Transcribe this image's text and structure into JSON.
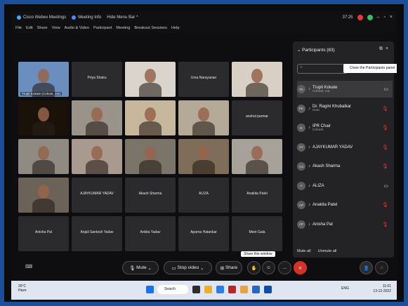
{
  "titlebar": {
    "app": "Cisco Webex Meetings",
    "meeting_info": "Meeting Info",
    "hide_menu": "Hide Menu Bar ^",
    "timer": "37:25"
  },
  "menu": [
    "File",
    "Edit",
    "Share",
    "View",
    "Audio & Video",
    "Participant",
    "Meeting",
    "Breakout Sessions",
    "Help"
  ],
  "tiles": [
    {
      "name": "Trupti Kokate (Cohost, me)",
      "video": true,
      "bg": "#6a8fbf"
    },
    {
      "name": "Priya Shaku",
      "video": false
    },
    {
      "name": "",
      "video": true,
      "bg": "#d9d4cc"
    },
    {
      "name": "Uma Narayanan",
      "video": false
    },
    {
      "name": "",
      "video": true,
      "bg": "#d8d0c4"
    },
    {
      "name": "",
      "video": true,
      "bg": "#1a1208"
    },
    {
      "name": "",
      "video": true,
      "bg": "#9a9389"
    },
    {
      "name": "",
      "video": true,
      "bg": "#c7b79c"
    },
    {
      "name": "",
      "video": true,
      "bg": "#b5aa98"
    },
    {
      "name": "anshul parmar",
      "video": false
    },
    {
      "name": "",
      "video": true,
      "bg": "#8f8a82"
    },
    {
      "name": "",
      "video": true,
      "bg": "#a89a8e"
    },
    {
      "name": "",
      "video": true,
      "bg": "#7b7468"
    },
    {
      "name": "",
      "video": true,
      "bg": "#7e6d58"
    },
    {
      "name": "",
      "video": true,
      "bg": "#a6a29a"
    },
    {
      "name": "",
      "video": true,
      "bg": "#6b6358"
    },
    {
      "name": "AJAYKUMAR YADAV",
      "video": false
    },
    {
      "name": "Akash Sharma",
      "video": false
    },
    {
      "name": "ALIZA",
      "video": false
    },
    {
      "name": "Anakita Patel",
      "video": false
    },
    {
      "name": "Anisha Pal",
      "video": false
    },
    {
      "name": "Anjali Santosh Yadav",
      "video": false
    },
    {
      "name": "Ankita Yadav",
      "video": false
    },
    {
      "name": "Aparna Hatankar",
      "video": false
    },
    {
      "name": "Meet Gala",
      "video": false
    }
  ],
  "panel": {
    "title": "Participants (83)",
    "tooltip": "Close the Participants panel",
    "participants": [
      {
        "initials": "TK",
        "name": "Trupti Kokate",
        "role": "Cohost, me",
        "muted": false,
        "selected": true
      },
      {
        "initials": "DK",
        "name": "Dr. Ragini Khubalkar",
        "role": "Host",
        "muted": true,
        "selected": false
      },
      {
        "initials": "IC",
        "name": "IPR Chair",
        "role": "Cohost",
        "muted": true,
        "selected": false
      },
      {
        "initials": "AY",
        "name": "AJAYKUMAR YADAV",
        "role": "",
        "muted": true,
        "selected": false
      },
      {
        "initials": "AS",
        "name": "Akash Sharma",
        "role": "",
        "muted": true,
        "selected": false
      },
      {
        "initials": "A",
        "name": "ALIZA",
        "role": "",
        "muted": false,
        "selected": false
      },
      {
        "initials": "AP",
        "name": "Anakita Patel",
        "role": "",
        "muted": true,
        "selected": false
      },
      {
        "initials": "AP",
        "name": "Anisha Pal",
        "role": "",
        "muted": true,
        "selected": false
      }
    ],
    "mute_all": "Mute all",
    "unmute_all": "Unmute all"
  },
  "toolbar": {
    "mute": "Mute",
    "stop_video": "Stop video",
    "share": "Share",
    "tooltip": "Share this window"
  },
  "taskbar": {
    "weather_temp": "26°C",
    "weather_desc": "Haze",
    "search": "Search",
    "lang": "ENG",
    "lang2": "IN",
    "time": "11:01",
    "date": "13-12-2022"
  },
  "colors": {
    "accent_red": "#d93025",
    "panel_bg": "#232325",
    "frame_border": "#1b4f9c"
  }
}
